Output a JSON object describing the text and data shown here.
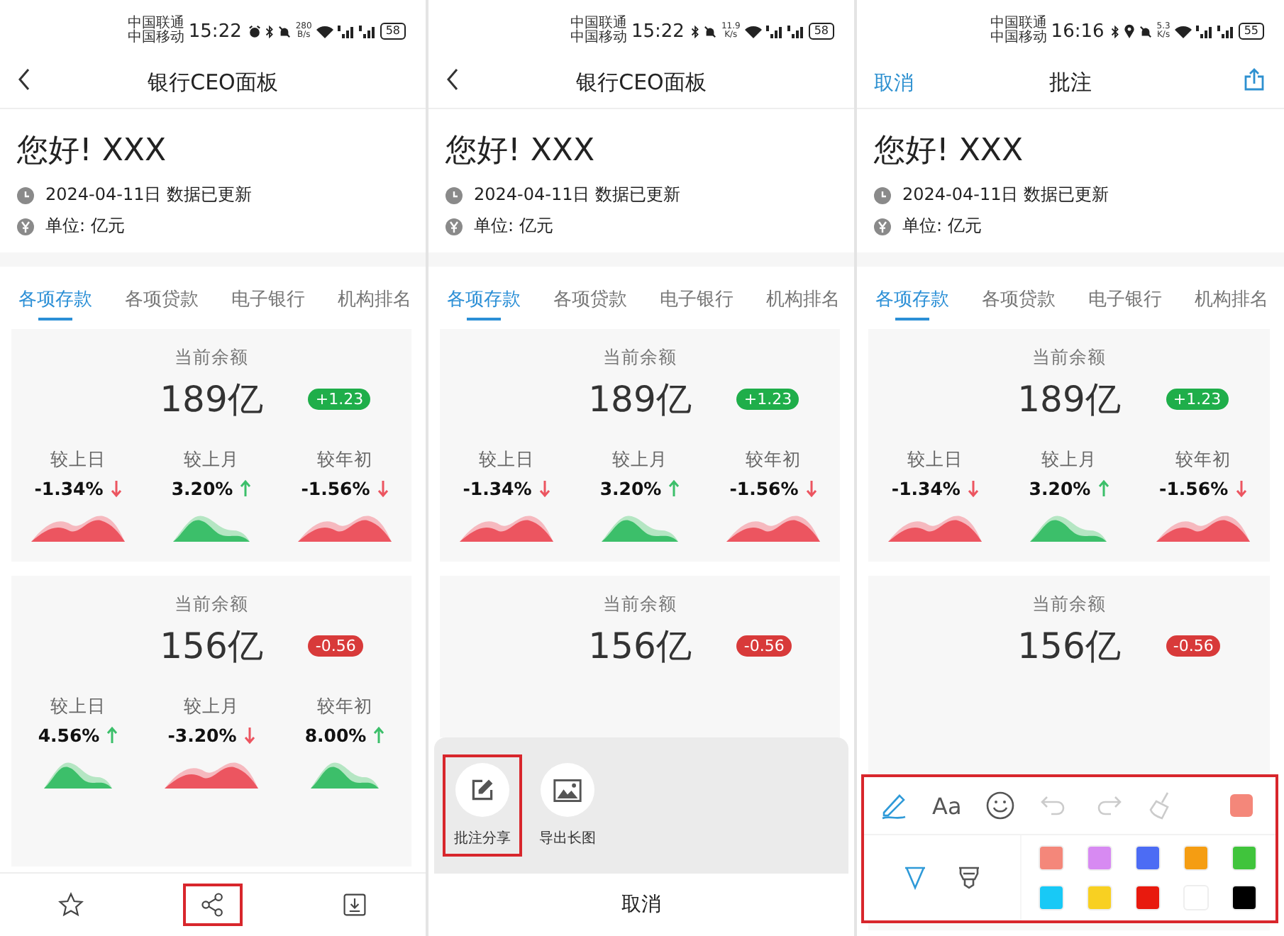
{
  "phones": [
    {
      "status_bar": {
        "carrier_1": "中国联通",
        "carrier_2": "中国移动",
        "time": "15:22",
        "icons": [
          {
            "kind": "alarm"
          },
          {
            "kind": "bluetooth"
          },
          {
            "kind": "mute"
          }
        ],
        "speed_value": "280",
        "speed_unit": "B/s",
        "battery": "58"
      },
      "header": {
        "left_action": {
          "kind": "back"
        },
        "title": "银行CEO面板"
      },
      "greeting": "您好! XXX",
      "date_line": "2024-04-11日 数据已更新",
      "unit_line": "单位: 亿元",
      "tabs": [
        {
          "label": "各项存款",
          "selected": true
        },
        {
          "label": "各项贷款",
          "selected": false
        },
        {
          "label": "电子银行",
          "selected": false
        },
        {
          "label": "机构排名",
          "selected": false
        }
      ],
      "cards": [
        {
          "label": "当前余额",
          "amount": "189亿",
          "change": "+1.23",
          "color": "#1fae4a",
          "metrics": [
            {
              "label": "较上日",
              "value": "-1.34%",
              "kind": "down"
            },
            {
              "label": "较上月",
              "value": "3.20%",
              "kind": "up"
            },
            {
              "label": "较年初",
              "value": "-1.56%",
              "kind": "down"
            }
          ]
        },
        {
          "label": "当前余额",
          "amount": "156亿",
          "change": "-0.56",
          "color": "#d83a3a",
          "metrics": [
            {
              "label": "较上日",
              "value": "4.56%",
              "kind": "up"
            },
            {
              "label": "较上月",
              "value": "-3.20%",
              "kind": "down"
            },
            {
              "label": "较年初",
              "value": "8.00%",
              "kind": "up"
            }
          ]
        }
      ],
      "bottom_bar": {
        "buttons": [
          {
            "kind": "star",
            "highlighted": false
          },
          {
            "kind": "share",
            "highlighted": true
          },
          {
            "kind": "download",
            "highlighted": false
          }
        ]
      }
    },
    {
      "status_bar": {
        "carrier_1": "中国联通",
        "carrier_2": "中国移动",
        "time": "15:22",
        "icons": [
          {
            "kind": "bluetooth"
          },
          {
            "kind": "mute"
          }
        ],
        "speed_value": "11.9",
        "speed_unit": "K/s",
        "battery": "58"
      },
      "header": {
        "left_action": {
          "kind": "back"
        },
        "title": "银行CEO面板"
      },
      "greeting": "您好! XXX",
      "date_line": "2024-04-11日 数据已更新",
      "unit_line": "单位: 亿元",
      "tabs": [
        {
          "label": "各项存款",
          "selected": true
        },
        {
          "label": "各项贷款",
          "selected": false
        },
        {
          "label": "电子银行",
          "selected": false
        },
        {
          "label": "机构排名",
          "selected": false
        }
      ],
      "cards": [
        {
          "label": "当前余额",
          "amount": "189亿",
          "change": "+1.23",
          "color": "#1fae4a",
          "metrics": [
            {
              "label": "较上日",
              "value": "-1.34%",
              "kind": "down"
            },
            {
              "label": "较上月",
              "value": "3.20%",
              "kind": "up"
            },
            {
              "label": "较年初",
              "value": "-1.56%",
              "kind": "down"
            }
          ]
        },
        {
          "label": "当前余额",
          "amount": "156亿",
          "change": "-0.56",
          "color": "#d83a3a"
        }
      ],
      "share_sheet": {
        "actions": [
          {
            "kind": "annotate",
            "label": "批注分享",
            "highlighted": true
          },
          {
            "kind": "image",
            "label": "导出长图",
            "highlighted": false
          }
        ],
        "cancel": "取消"
      }
    },
    {
      "status_bar": {
        "carrier_1": "中国联通",
        "carrier_2": "中国移动",
        "time": "16:16",
        "icons": [
          {
            "kind": "bluetooth"
          },
          {
            "kind": "location"
          },
          {
            "kind": "mute"
          }
        ],
        "speed_value": "5.3",
        "speed_unit": "K/s",
        "battery": "55"
      },
      "header": {
        "left_action": {
          "kind": "text",
          "label": "取消"
        },
        "title": "批注",
        "right_action": {
          "kind": "share"
        }
      },
      "greeting": "您好! XXX",
      "date_line": "2024-04-11日 数据已更新",
      "unit_line": "单位: 亿元",
      "tabs": [
        {
          "label": "各项存款",
          "selected": true
        },
        {
          "label": "各项贷款",
          "selected": false
        },
        {
          "label": "电子银行",
          "selected": false
        },
        {
          "label": "机构排名",
          "selected": false
        }
      ],
      "cards": [
        {
          "label": "当前余额",
          "amount": "189亿",
          "change": "+1.23",
          "color": "#1fae4a",
          "metrics": [
            {
              "label": "较上日",
              "value": "-1.34%",
              "kind": "down"
            },
            {
              "label": "较上月",
              "value": "3.20%",
              "kind": "up"
            },
            {
              "label": "较年初",
              "value": "-1.56%",
              "kind": "down"
            }
          ]
        },
        {
          "label": "当前余额",
          "amount": "156亿",
          "change": "-0.56",
          "color": "#d83a3a"
        }
      ],
      "annotation_toolbar": {
        "highlighted": true,
        "tools": [
          {
            "kind": "pen",
            "selected": true,
            "disabled": false
          },
          {
            "kind": "text",
            "glyph": "Aa",
            "selected": false,
            "disabled": false
          },
          {
            "kind": "emoji",
            "selected": false,
            "disabled": false
          },
          {
            "kind": "undo",
            "selected": false,
            "disabled": true
          },
          {
            "kind": "redo",
            "selected": false,
            "disabled": true
          },
          {
            "kind": "eraser",
            "selected": false,
            "disabled": true
          }
        ],
        "current_swatch": {
          "color": "#f4877a"
        },
        "brushes": [
          {
            "kind": "pen",
            "selected": true
          },
          {
            "kind": "marker",
            "selected": false
          }
        ],
        "palette": [
          {
            "color": "#f4877a"
          },
          {
            "color": "#d78af2"
          },
          {
            "color": "#4c6cf4"
          },
          {
            "color": "#f59d12"
          },
          {
            "color": "#40c43c"
          },
          {
            "color": "#18c9f6"
          },
          {
            "color": "#f8d022"
          },
          {
            "color": "#e81a0e"
          },
          {
            "color": "#ffffff"
          },
          {
            "color": "#000000"
          }
        ]
      }
    }
  ]
}
